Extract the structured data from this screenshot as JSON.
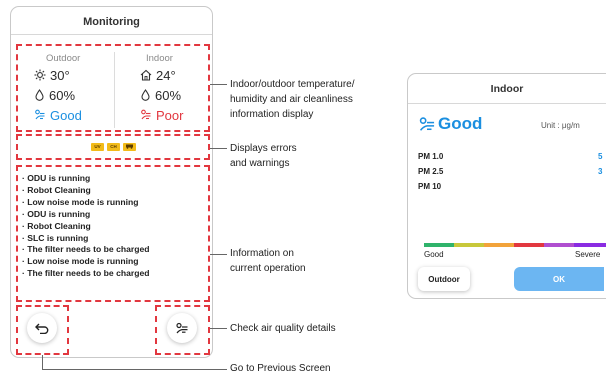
{
  "monitor": {
    "title": "Monitoring",
    "outdoor": {
      "label": "Outdoor",
      "temp": "30°",
      "humidity": "60%",
      "air": "Good"
    },
    "indoor": {
      "label": "Indoor",
      "temp": "24°",
      "humidity": "60%",
      "air": "Poor"
    },
    "badges": [
      "UV",
      "CH",
      "icon"
    ],
    "operations": [
      "· ODU is running",
      "· Robot Cleaning",
      "· Low noise mode is running",
      "· ODU is running",
      "· Robot Cleaning",
      "· SLC is running",
      "· The filter needs to be charged",
      "· Low noise mode is running",
      "· The filter needs to be charged"
    ]
  },
  "callouts": {
    "info_l1": "Indoor/outdoor temperature/",
    "info_l2": "humidity and air cleanliness",
    "info_l3": "information display",
    "err_l1": "Displays errors",
    "err_l2": "and warnings",
    "op_l1": "Information on",
    "op_l2": "current operation",
    "check": "Check air quality details",
    "prev": "Go to Previous Screen"
  },
  "detail": {
    "title": "Indoor",
    "status": "Good",
    "unit": "Unit : μg/m",
    "rows": [
      {
        "label": "PM 1.0",
        "value": "5"
      },
      {
        "label": "PM 2.5",
        "value": "3"
      },
      {
        "label": "PM 10",
        "value": ""
      }
    ],
    "scale_low": "Good",
    "scale_high": "Severe",
    "outdoor_button": "Outdoor",
    "ok_button": "OK"
  },
  "colors": {
    "accent_red": "#e2373f",
    "good_blue": "#1b8fe0",
    "badge_yellow": "#f2bb19",
    "scale": [
      "#2fb36b",
      "#c8c83a",
      "#f2a33a",
      "#e2373f",
      "#b04fd0",
      "#8a2be2"
    ]
  }
}
